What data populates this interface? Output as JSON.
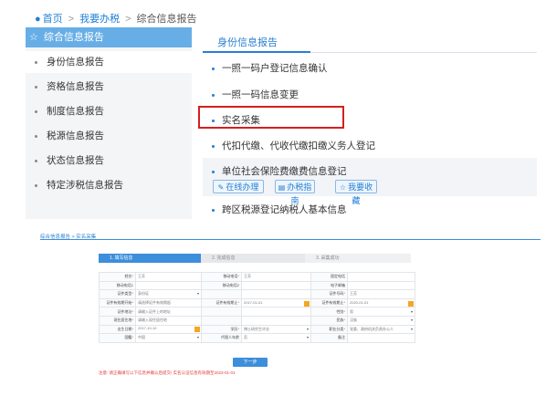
{
  "breadcrumb": {
    "home": "首页",
    "section": "我要办税",
    "current": "综合信息报告"
  },
  "sidebar": {
    "title": "综合信息报告",
    "items": [
      {
        "label": "身份信息报告"
      },
      {
        "label": "资格信息报告"
      },
      {
        "label": "制度信息报告"
      },
      {
        "label": "税源信息报告"
      },
      {
        "label": "状态信息报告"
      },
      {
        "label": "特定涉税信息报告"
      }
    ]
  },
  "main": {
    "tab_title": "身份信息报告",
    "items": [
      {
        "label": "一照一码户登记信息确认"
      },
      {
        "label": "一照一码信息变更"
      },
      {
        "label": "实名采集"
      },
      {
        "label": "代扣代缴、代收代缴扣缴义务人登记"
      },
      {
        "label": "单位社会保险费缴费信息登记"
      },
      {
        "label": "跨区税源登记纳税人基本信息"
      }
    ],
    "actions": [
      {
        "label": "在线办理",
        "icon": "edit-icon"
      },
      {
        "label": "办税指南",
        "icon": "guide-icon"
      },
      {
        "label": "我要收藏",
        "icon": "star-icon"
      }
    ]
  },
  "sub": {
    "breadcrumb": "综合信息报告 > 实名采集",
    "steps": [
      {
        "label": "1. 填写信息"
      },
      {
        "label": "2. 完成信息"
      },
      {
        "label": "3. 采集成功"
      }
    ],
    "rows": [
      [
        "姓名",
        "王芳",
        "移动电话",
        "王芳",
        "固定电话",
        ""
      ],
      [
        "移动电话1",
        "",
        "移动电话2",
        "",
        "电子邮箱",
        ""
      ],
      [
        "证件类型",
        "身份证",
        "",
        "",
        "证件号码",
        "王芳"
      ],
      [
        "证件有效期开始",
        "请选择证件有效期起",
        "证件有效期止",
        "2017-01-01",
        "证件有效期止",
        "2020-01-01"
      ],
      [
        "证件地址",
        "请输入证件上的地址",
        "",
        "",
        "性别",
        "男"
      ],
      [
        "现住居住地",
        "请输入现住居住地",
        "",
        "",
        "民族",
        "汉族"
      ],
      [
        "出生日期",
        "2017-10-10",
        "学历",
        "博士研究生毕业",
        "职业分类",
        "党委、政府机关负责办公人"
      ],
      [
        "国籍",
        "中国",
        "代理人年龄",
        "否",
        "备注",
        ""
      ]
    ],
    "next_button": "下一步",
    "note": "注意: 请正确填写以下信息并确认后提交! 实名认证信息有效期至2023-01-01"
  }
}
